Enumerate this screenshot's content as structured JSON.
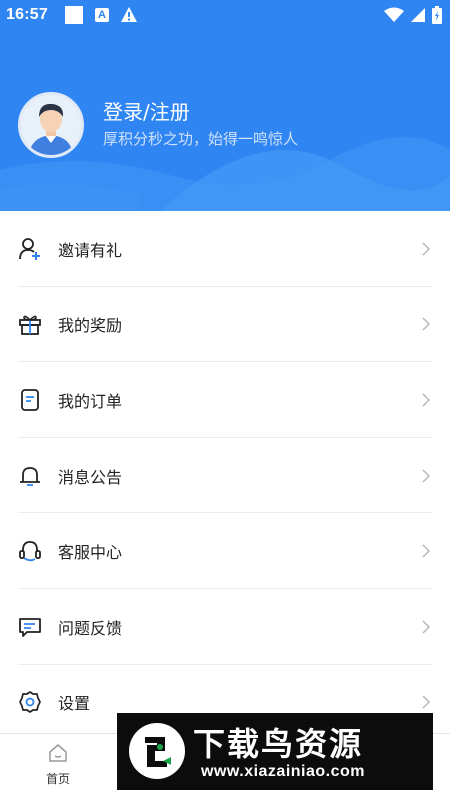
{
  "status_bar": {
    "time": "16:57",
    "icons": [
      "notification-square-icon",
      "a-icon",
      "warning-icon",
      "wifi-icon",
      "signal-icon",
      "battery-icon"
    ]
  },
  "profile": {
    "title": "登录/注册",
    "subtitle": "厚积分秒之功，始得一鸣惊人"
  },
  "menu": {
    "items": [
      {
        "label": "邀请有礼",
        "icon": "add-user-icon"
      },
      {
        "label": "我的奖励",
        "icon": "gift-icon"
      },
      {
        "label": "我的订单",
        "icon": "order-document-icon"
      },
      {
        "label": "消息公告",
        "icon": "bell-icon"
      },
      {
        "label": "客服中心",
        "icon": "headset-icon"
      },
      {
        "label": "问题反馈",
        "icon": "feedback-message-icon"
      },
      {
        "label": "设置",
        "icon": "gear-icon"
      }
    ]
  },
  "bottom_nav": {
    "home_label": "首页"
  },
  "watermark": {
    "title": "下载鸟资源",
    "url": "www.xiazainiao.com"
  },
  "colors": {
    "header_blue": "#2f86f3",
    "icon_accent": "#2f86f3",
    "text": "#222222",
    "divider": "#ececec"
  }
}
